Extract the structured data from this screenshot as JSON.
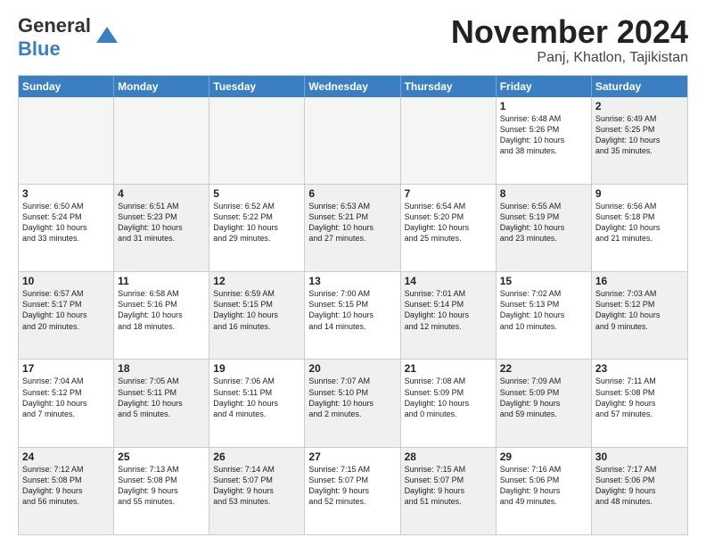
{
  "logo": {
    "general": "General",
    "blue": "Blue"
  },
  "title": "November 2024",
  "subtitle": "Panj, Khatlon, Tajikistan",
  "days": [
    "Sunday",
    "Monday",
    "Tuesday",
    "Wednesday",
    "Thursday",
    "Friday",
    "Saturday"
  ],
  "weeks": [
    [
      {
        "day": "",
        "text": "",
        "empty": true
      },
      {
        "day": "",
        "text": "",
        "empty": true
      },
      {
        "day": "",
        "text": "",
        "empty": true
      },
      {
        "day": "",
        "text": "",
        "empty": true
      },
      {
        "day": "",
        "text": "",
        "empty": true
      },
      {
        "day": "1",
        "text": "Sunrise: 6:48 AM\nSunset: 5:26 PM\nDaylight: 10 hours\nand 38 minutes."
      },
      {
        "day": "2",
        "text": "Sunrise: 6:49 AM\nSunset: 5:25 PM\nDaylight: 10 hours\nand 35 minutes.",
        "shaded": true
      }
    ],
    [
      {
        "day": "3",
        "text": "Sunrise: 6:50 AM\nSunset: 5:24 PM\nDaylight: 10 hours\nand 33 minutes."
      },
      {
        "day": "4",
        "text": "Sunrise: 6:51 AM\nSunset: 5:23 PM\nDaylight: 10 hours\nand 31 minutes.",
        "shaded": true
      },
      {
        "day": "5",
        "text": "Sunrise: 6:52 AM\nSunset: 5:22 PM\nDaylight: 10 hours\nand 29 minutes."
      },
      {
        "day": "6",
        "text": "Sunrise: 6:53 AM\nSunset: 5:21 PM\nDaylight: 10 hours\nand 27 minutes.",
        "shaded": true
      },
      {
        "day": "7",
        "text": "Sunrise: 6:54 AM\nSunset: 5:20 PM\nDaylight: 10 hours\nand 25 minutes."
      },
      {
        "day": "8",
        "text": "Sunrise: 6:55 AM\nSunset: 5:19 PM\nDaylight: 10 hours\nand 23 minutes.",
        "shaded": true
      },
      {
        "day": "9",
        "text": "Sunrise: 6:56 AM\nSunset: 5:18 PM\nDaylight: 10 hours\nand 21 minutes."
      }
    ],
    [
      {
        "day": "10",
        "text": "Sunrise: 6:57 AM\nSunset: 5:17 PM\nDaylight: 10 hours\nand 20 minutes.",
        "shaded": true
      },
      {
        "day": "11",
        "text": "Sunrise: 6:58 AM\nSunset: 5:16 PM\nDaylight: 10 hours\nand 18 minutes."
      },
      {
        "day": "12",
        "text": "Sunrise: 6:59 AM\nSunset: 5:15 PM\nDaylight: 10 hours\nand 16 minutes.",
        "shaded": true
      },
      {
        "day": "13",
        "text": "Sunrise: 7:00 AM\nSunset: 5:15 PM\nDaylight: 10 hours\nand 14 minutes."
      },
      {
        "day": "14",
        "text": "Sunrise: 7:01 AM\nSunset: 5:14 PM\nDaylight: 10 hours\nand 12 minutes.",
        "shaded": true
      },
      {
        "day": "15",
        "text": "Sunrise: 7:02 AM\nSunset: 5:13 PM\nDaylight: 10 hours\nand 10 minutes."
      },
      {
        "day": "16",
        "text": "Sunrise: 7:03 AM\nSunset: 5:12 PM\nDaylight: 10 hours\nand 9 minutes.",
        "shaded": true
      }
    ],
    [
      {
        "day": "17",
        "text": "Sunrise: 7:04 AM\nSunset: 5:12 PM\nDaylight: 10 hours\nand 7 minutes."
      },
      {
        "day": "18",
        "text": "Sunrise: 7:05 AM\nSunset: 5:11 PM\nDaylight: 10 hours\nand 5 minutes.",
        "shaded": true
      },
      {
        "day": "19",
        "text": "Sunrise: 7:06 AM\nSunset: 5:11 PM\nDaylight: 10 hours\nand 4 minutes."
      },
      {
        "day": "20",
        "text": "Sunrise: 7:07 AM\nSunset: 5:10 PM\nDaylight: 10 hours\nand 2 minutes.",
        "shaded": true
      },
      {
        "day": "21",
        "text": "Sunrise: 7:08 AM\nSunset: 5:09 PM\nDaylight: 10 hours\nand 0 minutes."
      },
      {
        "day": "22",
        "text": "Sunrise: 7:09 AM\nSunset: 5:09 PM\nDaylight: 9 hours\nand 59 minutes.",
        "shaded": true
      },
      {
        "day": "23",
        "text": "Sunrise: 7:11 AM\nSunset: 5:08 PM\nDaylight: 9 hours\nand 57 minutes."
      }
    ],
    [
      {
        "day": "24",
        "text": "Sunrise: 7:12 AM\nSunset: 5:08 PM\nDaylight: 9 hours\nand 56 minutes.",
        "shaded": true
      },
      {
        "day": "25",
        "text": "Sunrise: 7:13 AM\nSunset: 5:08 PM\nDaylight: 9 hours\nand 55 minutes."
      },
      {
        "day": "26",
        "text": "Sunrise: 7:14 AM\nSunset: 5:07 PM\nDaylight: 9 hours\nand 53 minutes.",
        "shaded": true
      },
      {
        "day": "27",
        "text": "Sunrise: 7:15 AM\nSunset: 5:07 PM\nDaylight: 9 hours\nand 52 minutes."
      },
      {
        "day": "28",
        "text": "Sunrise: 7:15 AM\nSunset: 5:07 PM\nDaylight: 9 hours\nand 51 minutes.",
        "shaded": true
      },
      {
        "day": "29",
        "text": "Sunrise: 7:16 AM\nSunset: 5:06 PM\nDaylight: 9 hours\nand 49 minutes."
      },
      {
        "day": "30",
        "text": "Sunrise: 7:17 AM\nSunset: 5:06 PM\nDaylight: 9 hours\nand 48 minutes.",
        "shaded": true
      }
    ]
  ]
}
